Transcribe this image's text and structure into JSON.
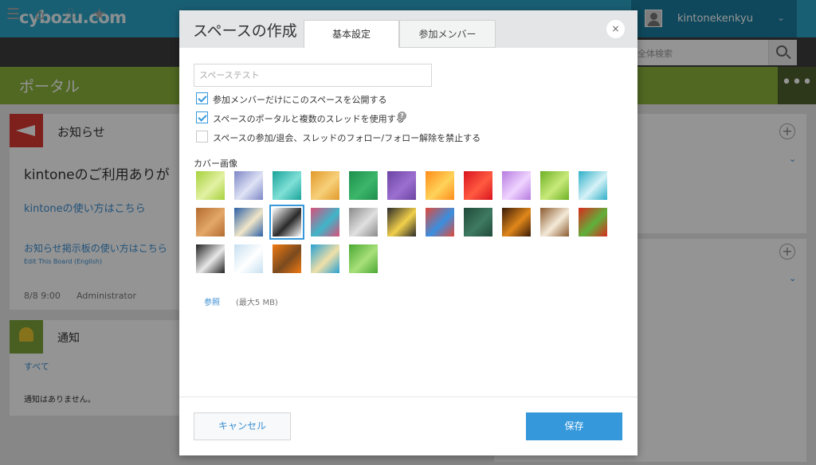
{
  "app": {
    "logo": "cybozu.com",
    "username": "kintonekenkyu",
    "search_placeholder": "全体検索",
    "portal_title": "ポータル",
    "more": "•••"
  },
  "notice_panel": {
    "title": "お知らせ",
    "heading": "kintoneのご利用ありが",
    "link_usage": "kintoneの使い方はこちら",
    "link_board": "お知らせ掲示板の使い方はこちら",
    "link_edit": "Edit This Board (English)",
    "date": "8/8 9:00",
    "author": "Administrator"
  },
  "notify_panel": {
    "title": "通知",
    "all_link": "すべて",
    "empty": "通知はありません。"
  },
  "dialog": {
    "title": "スペースの作成",
    "tabs": [
      "基本設定",
      "参加メンバー"
    ],
    "close": "×",
    "name_placeholder": "スペーステスト",
    "options": [
      {
        "label": "参加メンバーだけにこのスペースを公開する",
        "checked": true
      },
      {
        "label": "スペースのポータルと複数のスレッドを使用する",
        "checked": true
      },
      {
        "label": "スペースの参加/退会、スレッドのフォロー/フォロー解除を禁止する",
        "checked": false
      }
    ],
    "help": "?",
    "cover_label": "カバー画像",
    "covers": [
      {
        "name": "green-wave",
        "c1": "#a6d13b",
        "c2": "#e3f1a4"
      },
      {
        "name": "lavender-blur",
        "c1": "#7c86c6",
        "c2": "#dfe3f5"
      },
      {
        "name": "teal-water",
        "c1": "#1aa39a",
        "c2": "#7fe0d7"
      },
      {
        "name": "orange-texture",
        "c1": "#e19a2b",
        "c2": "#f7d07a"
      },
      {
        "name": "green-fabric",
        "c1": "#1e8f4c",
        "c2": "#3cb66a"
      },
      {
        "name": "purple-fabric",
        "c1": "#6c43a3",
        "c2": "#9a6fd0"
      },
      {
        "name": "orange-flower",
        "c1": "#ff8c1a",
        "c2": "#ffd35a"
      },
      {
        "name": "red-flower",
        "c1": "#d9141f",
        "c2": "#ff5a40"
      },
      {
        "name": "purple-bloom",
        "c1": "#b57be0",
        "c2": "#f0d4ff"
      },
      {
        "name": "green-leaf",
        "c1": "#6eb025",
        "c2": "#c8ea7a"
      },
      {
        "name": "teal-cubes",
        "c1": "#2fb0c8",
        "c2": "#d6f2f7"
      },
      {
        "name": "wood-parquet",
        "c1": "#b36b2f",
        "c2": "#e3a867"
      },
      {
        "name": "blue-tiles",
        "c1": "#2b5fa6",
        "c2": "#f0e6c8"
      },
      {
        "name": "compass",
        "c1": "#ffffff",
        "c2": "#2a2a2a"
      },
      {
        "name": "colored-pencils-stack",
        "c1": "#d94f7a",
        "c2": "#3fb5c9"
      },
      {
        "name": "keyboard",
        "c1": "#8a8a8a",
        "c2": "#e0e0e0"
      },
      {
        "name": "doodle-dark",
        "c1": "#2a2a2a",
        "c2": "#f2d04a"
      },
      {
        "name": "crayons",
        "c1": "#e04a3a",
        "c2": "#3a8fe0"
      },
      {
        "name": "lightbulb-chalk",
        "c1": "#204a3a",
        "c2": "#3f7a62"
      },
      {
        "name": "sunset-dark",
        "c1": "#3a1a08",
        "c2": "#e0871a"
      },
      {
        "name": "latte-art",
        "c1": "#8a5a2e",
        "c2": "#f4ead8"
      },
      {
        "name": "vegetables",
        "c1": "#d92b1e",
        "c2": "#5fb13a"
      },
      {
        "name": "phone-handset",
        "c1": "#222222",
        "c2": "#e8e8e8"
      },
      {
        "name": "snowy-trees",
        "c1": "#c6dff0",
        "c2": "#ffffff"
      },
      {
        "name": "oranges-basket",
        "c1": "#f07a12",
        "c2": "#7a4a1e"
      },
      {
        "name": "beach-palm",
        "c1": "#27a0d4",
        "c2": "#f0e0a8"
      },
      {
        "name": "bamboo",
        "c1": "#4aa832",
        "c2": "#a8e07a"
      }
    ],
    "selected_cover": "compass",
    "browse": "参照",
    "size_note": "(最大5 MB)",
    "cancel": "キャンセル",
    "save": "保存"
  }
}
